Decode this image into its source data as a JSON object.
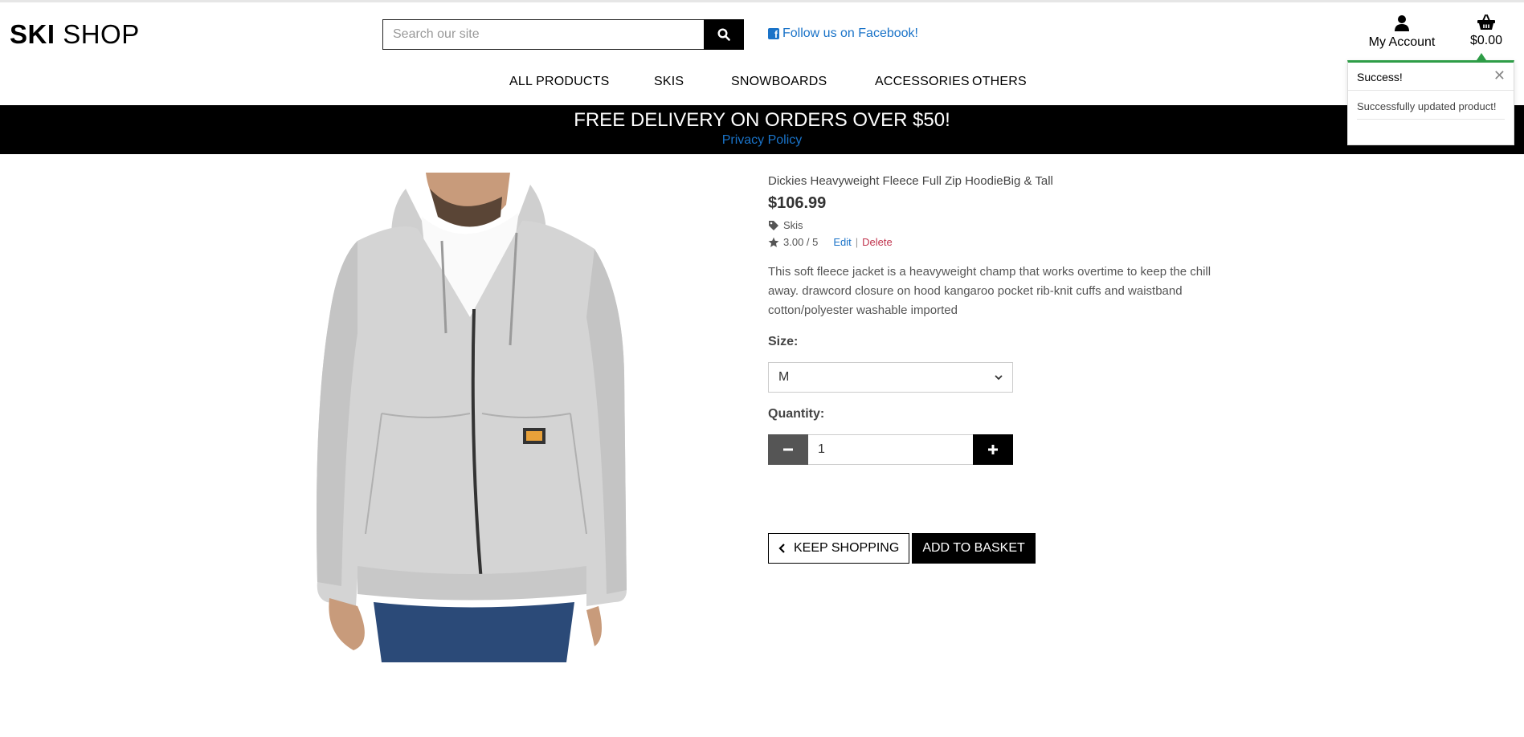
{
  "header": {
    "logo_bold": "SKI",
    "logo_light": "SHOP",
    "search_placeholder": "Search our site",
    "facebook_label": "Follow us on Facebook!",
    "account_label": "My Account",
    "basket_total": "$0.00"
  },
  "nav": {
    "items": [
      {
        "label": "ALL PRODUCTS"
      },
      {
        "label": "SKIS"
      },
      {
        "label": "SNOWBOARDS"
      },
      {
        "label": "ACCESSORIES"
      },
      {
        "label": "OTHERS"
      }
    ]
  },
  "banner": {
    "text": "FREE DELIVERY ON ORDERS OVER $50!",
    "privacy_link": "Privacy Policy"
  },
  "toast": {
    "title": "Success!",
    "message": "Successfully updated product!",
    "accent_color": "#2e9d47"
  },
  "product": {
    "name": "Dickies Heavyweight Fleece Full Zip HoodieBig & Tall",
    "price": "$106.99",
    "category": "Skis",
    "rating": "3.00 / 5",
    "edit_label": "Edit",
    "separator": "|",
    "delete_label": "Delete",
    "description": "This soft fleece jacket is a heavyweight champ that works overtime to keep the chill away. drawcord closure on hood kangaroo pocket rib-knit cuffs and waistband cotton/polyester washable imported",
    "size_label": "Size:",
    "size_value": "M",
    "quantity_label": "Quantity:",
    "quantity_value": "1",
    "keep_shopping_label": "KEEP SHOPPING",
    "add_to_basket_label": "ADD TO BASKET"
  },
  "colors": {
    "link_blue": "#1a73c8",
    "delete_red": "#c0334d",
    "banner_bg": "#000000"
  }
}
